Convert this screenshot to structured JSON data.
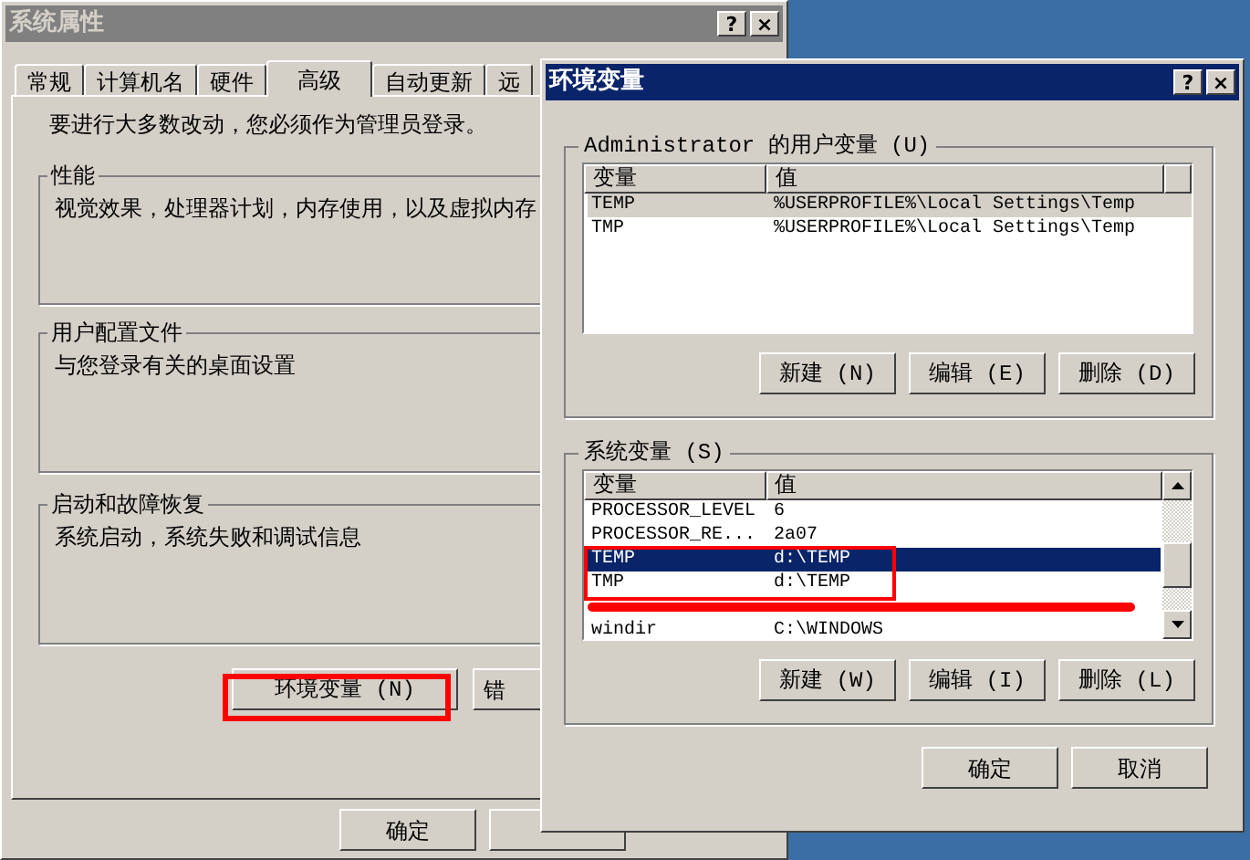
{
  "system_properties": {
    "title": "系统属性",
    "title_buttons": [
      "?",
      "×"
    ],
    "tabs": [
      {
        "label": "常规",
        "selected": false
      },
      {
        "label": "计算机名",
        "selected": false
      },
      {
        "label": "硬件",
        "selected": false
      },
      {
        "label": "高级",
        "selected": true
      },
      {
        "label": "自动更新",
        "selected": false
      },
      {
        "label": "远",
        "selected": false
      }
    ],
    "notice": "要进行大多数改动，您必须作为管理员登录。",
    "groups": [
      {
        "title": "性能",
        "description": "视觉效果，处理器计划，内存使用，以及虚拟内存"
      },
      {
        "title": "用户配置文件",
        "description": "与您登录有关的桌面设置"
      },
      {
        "title": "启动和故障恢复",
        "description": "系统启动，系统失败和调试信息"
      }
    ],
    "env_button": "环境变量 (N)",
    "error_button": "错",
    "ok_button": "确定"
  },
  "env_dialog": {
    "title": "环境变量",
    "title_buttons": [
      "?",
      "×"
    ],
    "lists": [
      {
        "title": "Administrator 的用户变量 (U)",
        "focused": false,
        "scrollbar": false,
        "columns": [
          "变量",
          "值"
        ],
        "rows": [
          {
            "name": "TEMP",
            "value": "%USERPROFILE%\\Local Settings\\Temp",
            "selected": true,
            "kind": "plain"
          },
          {
            "name": "TMP",
            "value": "%USERPROFILE%\\Local Settings\\Temp",
            "selected": false,
            "kind": "plain"
          }
        ],
        "buttons": [
          "新建 (N)",
          "编辑 (E)",
          "删除 (D)"
        ]
      },
      {
        "title": "系统变量 (S)",
        "focused": true,
        "scrollbar": true,
        "columns": [
          "变量",
          "值"
        ],
        "rows": [
          {
            "name": "PROCESSOR_LEVEL",
            "value": "6",
            "selected": false,
            "kind": "plain"
          },
          {
            "name": "PROCESSOR_RE...",
            "value": "2a07",
            "selected": false,
            "kind": "plain"
          },
          {
            "name": "TEMP",
            "value": "d:\\TEMP",
            "selected": true,
            "kind": "plain"
          },
          {
            "name": "TMP",
            "value": "d:\\TEMP",
            "selected": false,
            "kind": "plain"
          },
          {
            "kind": "redacted",
            "selected": false
          },
          {
            "name": "windir",
            "value": "C:\\WINDOWS",
            "selected": false,
            "kind": "plain"
          }
        ],
        "buttons": [
          "新建 (W)",
          "编辑 (I)",
          "删除 (L)"
        ]
      }
    ],
    "buttons": [
      "确定",
      "取消"
    ]
  }
}
